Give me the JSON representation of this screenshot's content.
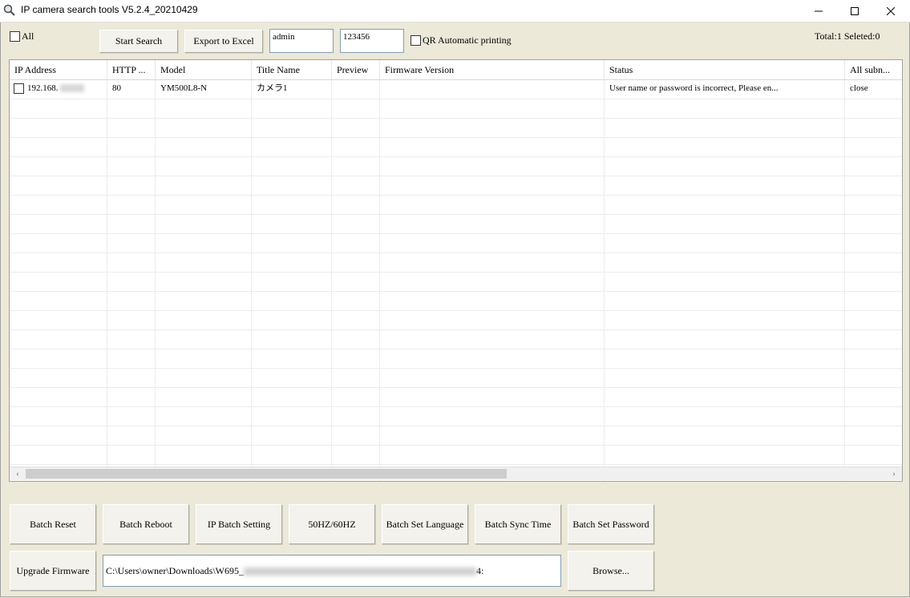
{
  "window": {
    "title": "IP camera search tools V5.2.4_20210429",
    "minimize_glyph": "—",
    "maximize_glyph": "☐",
    "close_glyph": "✕"
  },
  "toolbar": {
    "all_label": "All",
    "start_search_label": "Start Search",
    "export_excel_label": "Export to Excel",
    "username_value": "admin",
    "password_value": "123456",
    "qr_label": "QR Automatic printing",
    "summary": "Total:1 Seleted:0"
  },
  "table": {
    "columns": [
      "IP Address",
      "HTTP ...",
      "Model",
      "Title Name",
      "Preview",
      "Firmware Version",
      "Status",
      "All subn..."
    ],
    "rows": [
      {
        "ip": "192.168.",
        "http": "80",
        "model": "YM500L8-N",
        "title_name": "カメラ1",
        "preview": "",
        "firmware": "",
        "status": "User name or password is incorrect, Please en...",
        "subnet": "close"
      }
    ]
  },
  "scroll": {
    "left_glyph": "‹",
    "right_glyph": "›"
  },
  "actions": {
    "batch_reset": "Batch Reset",
    "batch_reboot": "Batch Reboot",
    "ip_batch_setting": "IP Batch Setting",
    "hz": "50HZ/60HZ",
    "batch_set_language": "Batch Set Language",
    "batch_sync_time": "Batch Sync Time",
    "batch_set_password": "Batch Set Password",
    "upgrade_firmware": "Upgrade Firmware",
    "firmware_path": "C:\\Users\\owner\\Downloads\\W695_",
    "firmware_path_tail": "4:",
    "browse": "Browse..."
  }
}
